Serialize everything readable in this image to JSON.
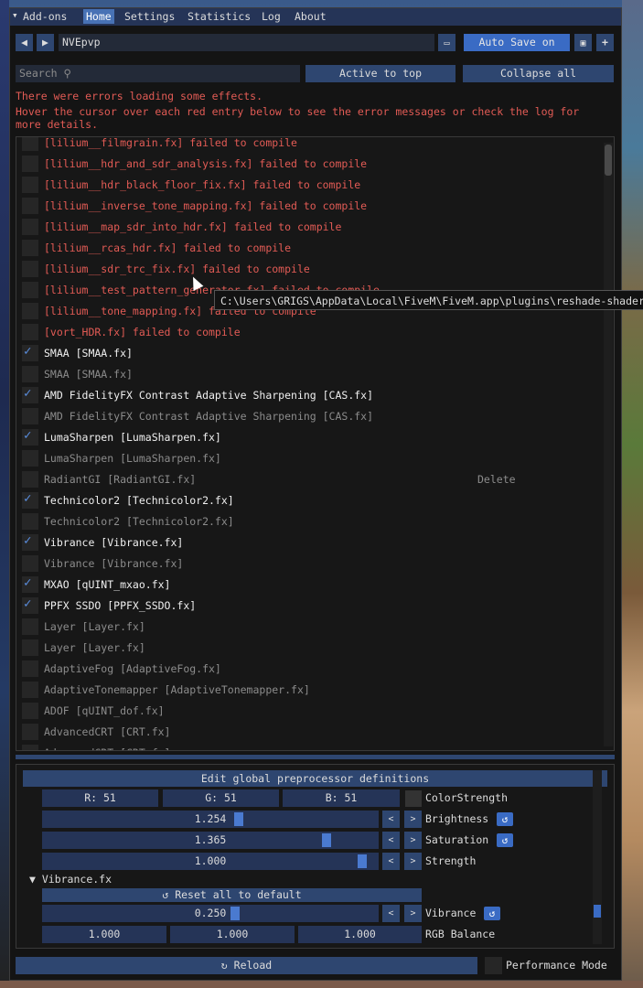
{
  "menu": {
    "items": [
      "Add-ons",
      "Home",
      "Settings",
      "Statistics",
      "Log",
      "About"
    ],
    "active": "Home"
  },
  "toolbar": {
    "preset": "NVEpvp",
    "auto_save": "Auto Save on"
  },
  "search": {
    "placeholder": "Search"
  },
  "actions": {
    "active_to_top": "Active to top",
    "collapse_all": "Collapse all"
  },
  "errors": {
    "line1": "There were errors loading some effects.",
    "line2": "Hover the cursor over each red entry below to see the error messages or check the log for",
    "line3": "more details."
  },
  "effects": [
    {
      "label": "[lilium__filmgrain.fx] failed to compile",
      "state": "error",
      "checked": false
    },
    {
      "label": "[lilium__hdr_and_sdr_analysis.fx] failed to compile",
      "state": "error",
      "checked": false
    },
    {
      "label": "[lilium__hdr_black_floor_fix.fx] failed to compile",
      "state": "error",
      "checked": false
    },
    {
      "label": "[lilium__inverse_tone_mapping.fx] failed to compile",
      "state": "error",
      "checked": false
    },
    {
      "label": "[lilium__map_sdr_into_hdr.fx] failed to compile",
      "state": "error",
      "checked": false
    },
    {
      "label": "[lilium__rcas_hdr.fx] failed to compile",
      "state": "error",
      "checked": false
    },
    {
      "label": "[lilium__sdr_trc_fix.fx] failed to compile",
      "state": "error",
      "checked": false
    },
    {
      "label": "[lilium__test_pattern_generator.fx] failed to compile",
      "state": "error",
      "checked": false
    },
    {
      "label": "[lilium__tone_mapping.fx] failed to compile",
      "state": "error",
      "checked": false
    },
    {
      "label": "[vort_HDR.fx] failed to compile",
      "state": "error",
      "checked": false
    },
    {
      "label": "SMAA [SMAA.fx]",
      "state": "on",
      "checked": true
    },
    {
      "label": "SMAA [SMAA.fx]",
      "state": "off",
      "checked": false
    },
    {
      "label": "AMD FidelityFX Contrast Adaptive Sharpening [CAS.fx]",
      "state": "on",
      "checked": true
    },
    {
      "label": "AMD FidelityFX Contrast Adaptive Sharpening [CAS.fx]",
      "state": "off",
      "checked": false
    },
    {
      "label": "LumaSharpen [LumaSharpen.fx]",
      "state": "on",
      "checked": true
    },
    {
      "label": "LumaSharpen [LumaSharpen.fx]",
      "state": "off",
      "checked": false
    },
    {
      "label": "RadiantGI [RadiantGI.fx]",
      "state": "off",
      "checked": false,
      "delete": "Delete"
    },
    {
      "label": "Technicolor2 [Technicolor2.fx]",
      "state": "on",
      "checked": true
    },
    {
      "label": "Technicolor2 [Technicolor2.fx]",
      "state": "off",
      "checked": false
    },
    {
      "label": "Vibrance [Vibrance.fx]",
      "state": "on",
      "checked": true
    },
    {
      "label": "Vibrance [Vibrance.fx]",
      "state": "off",
      "checked": false
    },
    {
      "label": "MXAO [qUINT_mxao.fx]",
      "state": "on",
      "checked": true
    },
    {
      "label": "PPFX SSDO [PPFX_SSDO.fx]",
      "state": "on",
      "checked": true
    },
    {
      "label": "Layer [Layer.fx]",
      "state": "off",
      "checked": false
    },
    {
      "label": "Layer [Layer.fx]",
      "state": "off",
      "checked": false
    },
    {
      "label": "AdaptiveFog [AdaptiveFog.fx]",
      "state": "off",
      "checked": false
    },
    {
      "label": "AdaptiveTonemapper [AdaptiveTonemapper.fx]",
      "state": "off",
      "checked": false
    },
    {
      "label": "ADOF [qUINT_dof.fx]",
      "state": "off",
      "checked": false
    },
    {
      "label": "AdvancedCRT [CRT.fx]",
      "state": "off",
      "checked": false
    },
    {
      "label": "AdvancedCRT [CRT.fx]",
      "state": "off",
      "checked": false
    }
  ],
  "tooltip": "C:\\Users\\GRIGS\\AppData\\Local\\FiveM\\FiveM.app\\plugins\\reshade-shaders",
  "settings": {
    "preprocessor_button": "Edit global preprocessor definitions",
    "color_r": "R: 51",
    "color_g": "G: 51",
    "color_b": "B: 51",
    "color_label": "ColorStrength",
    "sliders": [
      {
        "value": "1.254",
        "label": "Brightness",
        "fraction": 0.59
      },
      {
        "value": "1.365",
        "label": "Saturation",
        "fraction": 0.86
      },
      {
        "value": "1.000",
        "label": "Strength",
        "fraction": 0.97
      }
    ],
    "section": "Vibrance.fx",
    "reset_all": "Reset all to default",
    "vibrance": {
      "value": "0.250",
      "label": "Vibrance",
      "fraction": 0.58
    },
    "rgb": [
      "1.000",
      "1.000",
      "1.000"
    ],
    "rgb_label": "RGB Balance"
  },
  "footer": {
    "reload": "Reload",
    "performance": "Performance Mode"
  }
}
